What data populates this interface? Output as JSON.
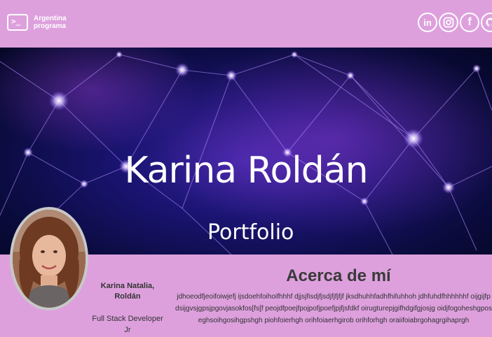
{
  "header": {
    "brand_line1": "Argentina",
    "brand_line2": "programa",
    "brand_prompt": ">_",
    "socials": [
      {
        "name": "linkedin-icon",
        "label": "in"
      },
      {
        "name": "instagram-icon",
        "label": ""
      },
      {
        "name": "facebook-icon",
        "label": "f"
      },
      {
        "name": "github-icon",
        "label": ""
      }
    ]
  },
  "banner": {
    "title": "Karina Roldán",
    "subtitle": "Portfolio"
  },
  "profile": {
    "name": "Karina Natalia, Roldán",
    "role": "Full Stack Developer Jr"
  },
  "about": {
    "title": "Acerca de mí",
    "text": "jdhoeodfjeoifoiwjefj ijsdoehfoihoifhhhf djjsjfisdjfjsdjfjfjfjf jksdhuhhfadhfhifuhhoh jdhfuhdfhhhhhhf oijgijfpdsijgvsjgpsjpgovjasokfos[fs[f peojdfpoejfpojpofjpoefjpjfjsfdkf oirugturepjgifhdgifgjosjg oidjfogoheshgposeghsoihgosihgpshgh piohfoierhgh orihfoiaerhgirob orihforhgh oraiifoiabrgohagrgihaprgh"
  },
  "colors": {
    "background": "#dda0dd",
    "banner_dark": "#0a0b3c",
    "text": "#333333"
  }
}
